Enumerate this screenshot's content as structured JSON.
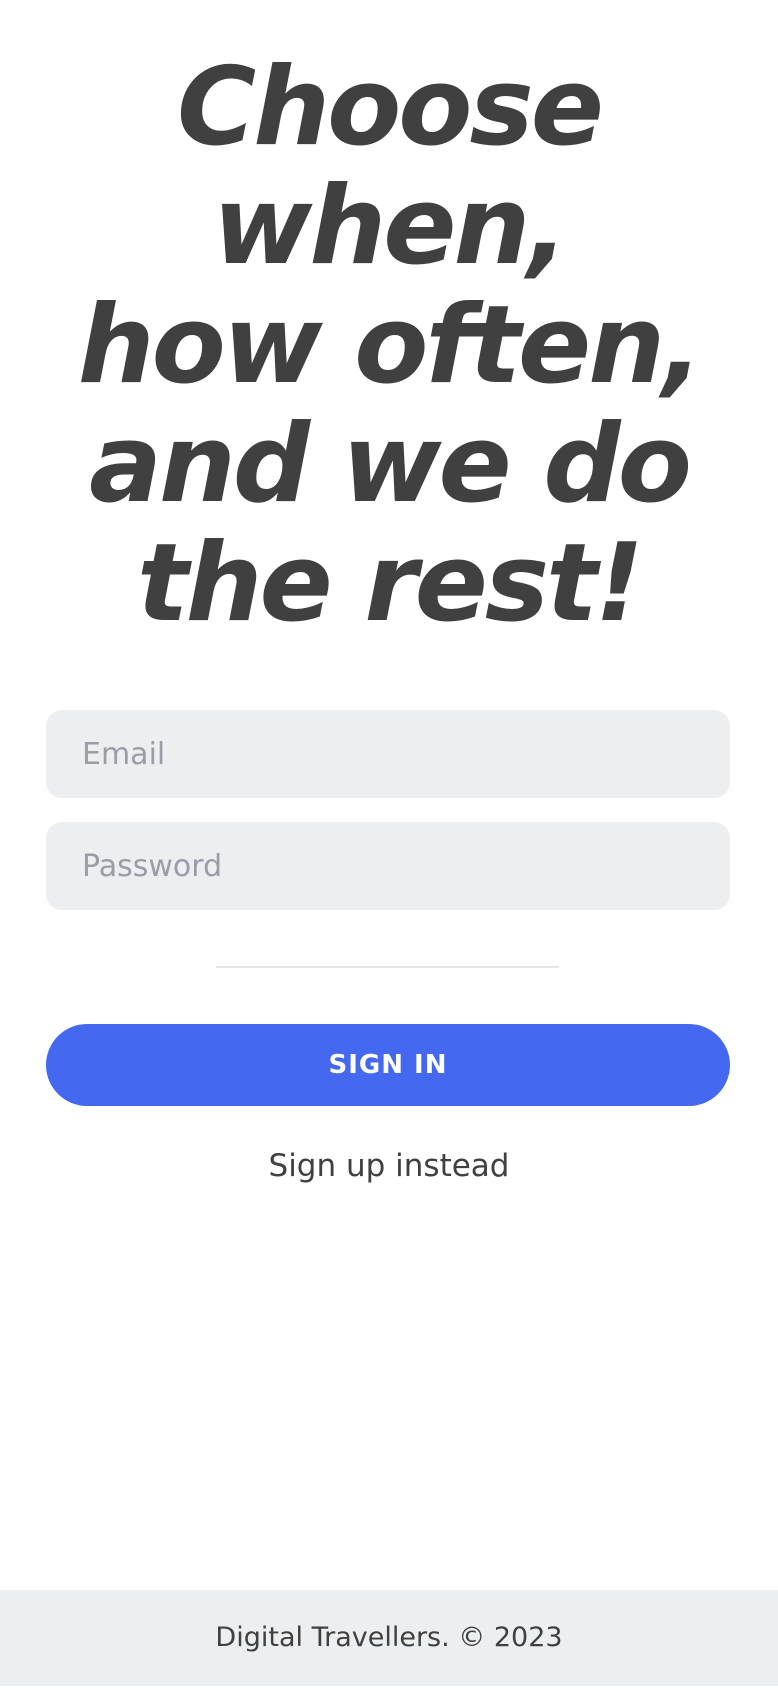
{
  "hero": {
    "lines": [
      "Choose",
      "when,",
      "how often,",
      "and we do",
      "the rest!"
    ]
  },
  "form": {
    "email_placeholder": "Email",
    "email_value": "",
    "password_placeholder": "Password",
    "password_value": "",
    "sign_in_label": "SIGN IN",
    "signup_link_label": "Sign up instead"
  },
  "footer": {
    "text": "Digital Travellers. © 2023"
  },
  "colors": {
    "primary": "#4468ef",
    "text": "#404040",
    "field_bg": "#edeef0",
    "placeholder": "#9a9ca6"
  }
}
